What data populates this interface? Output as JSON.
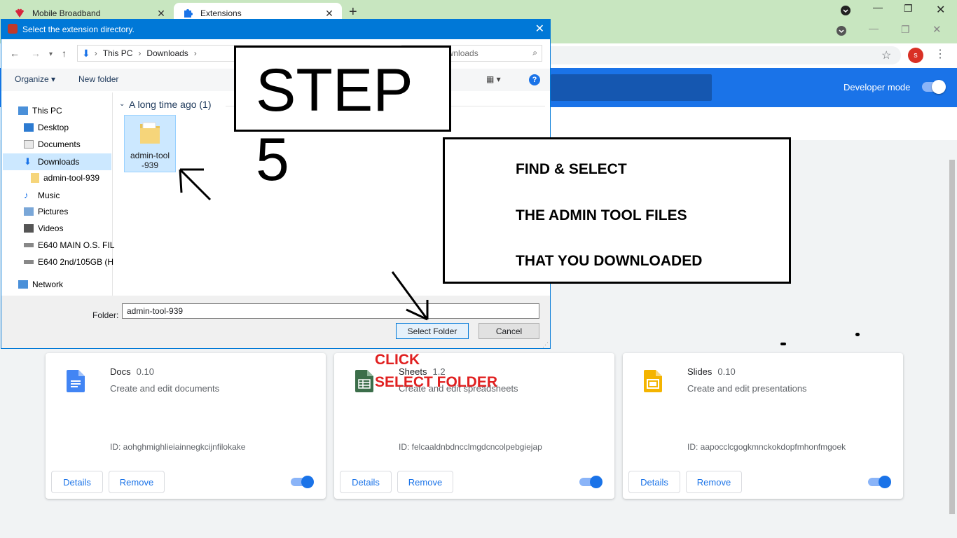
{
  "browser": {
    "tabs": [
      {
        "label": "Mobile Broadband",
        "icon": "huawei-icon",
        "active": false
      },
      {
        "label": "Extensions",
        "icon": "puzzle-icon",
        "active": true
      }
    ],
    "profile_initial": "s"
  },
  "extensions_page": {
    "developer_mode_label": "Developer mode",
    "developer_mode_on": true,
    "cards": [
      {
        "name": "Docs",
        "version": "0.10",
        "description": "Create and edit documents",
        "id": "ID: aohghmighlieiainnegkcijnfilokake",
        "details_label": "Details",
        "remove_label": "Remove",
        "enabled": true,
        "icon": "docs-icon",
        "icon_color": "#4285f4"
      },
      {
        "name": "Sheets",
        "version": "1.2",
        "description": "Create and edit spreadsheets",
        "id": "ID: felcaaldnbdncclmgdcncolpebgiejap",
        "details_label": "Details",
        "remove_label": "Remove",
        "enabled": true,
        "icon": "sheets-icon",
        "icon_color": "#3c6e4a"
      },
      {
        "name": "Slides",
        "version": "0.10",
        "description": "Create and edit presentations",
        "id": "ID: aapocclcgogkmnckokdopfmhonfmgoek",
        "details_label": "Details",
        "remove_label": "Remove",
        "enabled": true,
        "icon": "slides-icon",
        "icon_color": "#f4b400"
      }
    ]
  },
  "dialog": {
    "title": "Select the extension directory.",
    "breadcrumb": [
      "This PC",
      "Downloads"
    ],
    "search_placeholder": "Search Downloads",
    "organize_label": "Organize ▾",
    "new_folder_label": "New folder",
    "nav_items": [
      "This PC",
      "Desktop",
      "Documents",
      "Downloads",
      "admin-tool-939",
      "Music",
      "Pictures",
      "Videos",
      "E640 MAIN O.S. FIL",
      "E640  2nd/105GB (H",
      "Network"
    ],
    "group_header": "A long time ago (1)",
    "folder_item_name": "admin-tool-939",
    "folder_item_line1": "admin-tool",
    "folder_item_line2": "-939",
    "folder_label": "Folder:",
    "folder_value": "admin-tool-939",
    "select_button": "Select Folder",
    "cancel_button": "Cancel"
  },
  "annotations": {
    "step": "STEP 5",
    "info_lines": [
      "FIND & SELECT",
      "THE ADMIN TOOL FILES",
      "THAT YOU DOWNLOADED"
    ],
    "click_line1": "CLICK",
    "click_line2": "SELECT FOLDER"
  }
}
